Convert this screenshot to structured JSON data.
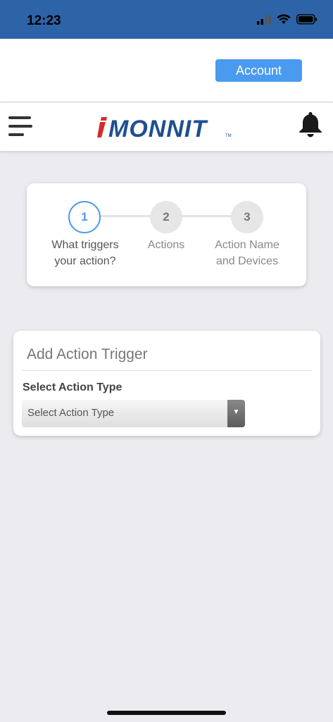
{
  "status_bar": {
    "time": "12:23"
  },
  "header": {
    "account_label": "Account"
  },
  "nav": {
    "logo_text": "MONNIT",
    "logo_prefix": "i",
    "logo_tm": "™"
  },
  "stepper": {
    "steps": [
      {
        "number": "1",
        "line1": "What triggers",
        "line2": "your action?"
      },
      {
        "number": "2",
        "line1": "Actions",
        "line2": ""
      },
      {
        "number": "3",
        "line1": "Action Name",
        "line2": "and Devices"
      }
    ]
  },
  "trigger_card": {
    "title": "Add Action Trigger",
    "select_label": "Select Action Type",
    "select_value": "Select Action Type",
    "select_arrow": "▼"
  },
  "colors": {
    "status_bar": "#2d64a8",
    "accent": "#4a9af0",
    "logo_red": "#d42c2c",
    "logo_blue": "#1f4f8f"
  }
}
